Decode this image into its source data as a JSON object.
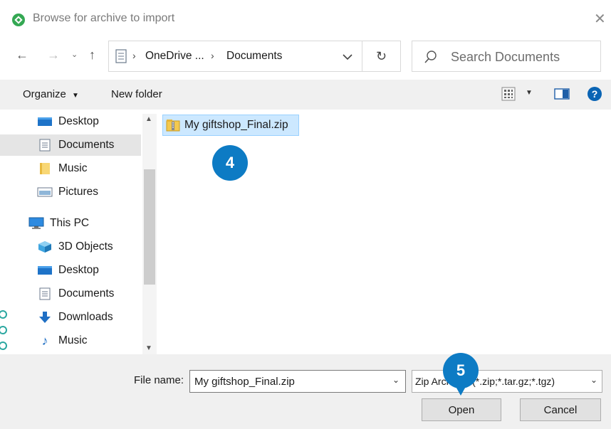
{
  "window": {
    "title": "Browse for archive to import"
  },
  "nav": {
    "breadcrumb": [
      "OneDrive ...",
      "Documents"
    ],
    "search_placeholder": "Search Documents"
  },
  "toolbar": {
    "organize_label": "Organize",
    "new_folder_label": "New folder"
  },
  "sidebar": {
    "quick_items": [
      {
        "label": "Desktop",
        "icon": "desktop-icon"
      },
      {
        "label": "Documents",
        "icon": "documents-icon",
        "selected": true
      },
      {
        "label": "Music",
        "icon": "folder-icon"
      },
      {
        "label": "Pictures",
        "icon": "pictures-icon"
      }
    ],
    "this_pc_label": "This PC",
    "pc_items": [
      {
        "label": "3D Objects",
        "icon": "3d-objects-icon"
      },
      {
        "label": "Desktop",
        "icon": "desktop-icon"
      },
      {
        "label": "Documents",
        "icon": "documents-icon"
      },
      {
        "label": "Downloads",
        "icon": "downloads-icon"
      },
      {
        "label": "Music",
        "icon": "music-icon"
      }
    ]
  },
  "files": [
    {
      "name": "My giftshop_Final.zip",
      "icon": "zip-folder-icon",
      "selected": true
    }
  ],
  "bottom": {
    "file_name_label": "File name:",
    "file_name_value": "My giftshop_Final.zip",
    "file_type_value": "Zip Archives (*.zip;*.tar.gz;*.tgz)",
    "open_label": "Open",
    "cancel_label": "Cancel"
  },
  "callouts": {
    "step_a": "4",
    "step_b": "5"
  },
  "colors": {
    "accent": "#0d7bc4",
    "selection": "#cce8ff",
    "help": "#0a64b4"
  }
}
